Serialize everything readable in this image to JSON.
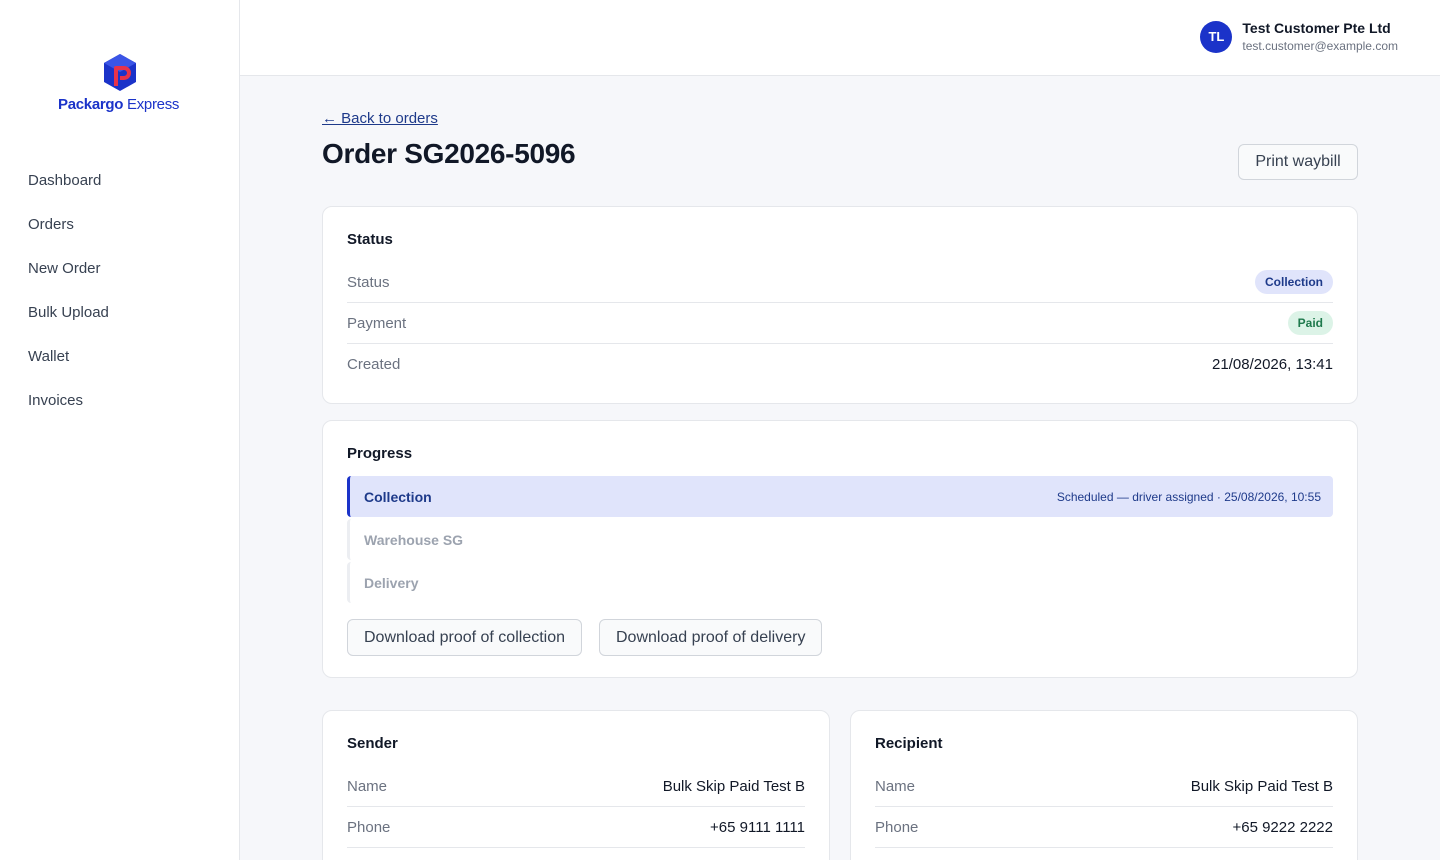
{
  "brand": {
    "name_bold": "Packargo",
    "name_light": " Express"
  },
  "sidebar": {
    "items": [
      {
        "label": "Dashboard"
      },
      {
        "label": "Orders"
      },
      {
        "label": "New Order"
      },
      {
        "label": "Bulk Upload"
      },
      {
        "label": "Wallet"
      },
      {
        "label": "Invoices"
      }
    ]
  },
  "user": {
    "initials": "TL",
    "name": "Test Customer Pte Ltd",
    "email": "test.customer@example.com"
  },
  "page": {
    "back_link": "← Back to orders",
    "title": "Order SG2026-5096",
    "print_label": "Print waybill"
  },
  "status_card": {
    "title": "Status",
    "status_label": "Status",
    "status_value": "Collection",
    "payment_label": "Payment",
    "payment_value": "Paid",
    "created_label": "Created",
    "created_value": "21/08/2026, 13:41"
  },
  "progress": {
    "title": "Progress",
    "steps": [
      {
        "name": "Collection",
        "info": "Scheduled — driver assigned · 25/08/2026, 10:55"
      },
      {
        "name": "Warehouse SG",
        "info": ""
      },
      {
        "name": "Delivery",
        "info": ""
      }
    ],
    "proof_collection_label": "Download proof of collection",
    "proof_delivery_label": "Download proof of delivery"
  },
  "sender": {
    "title": "Sender",
    "name_label": "Name",
    "name_value": "Bulk Skip Paid Test B",
    "phone_label": "Phone",
    "phone_value": "+65 9111 1111"
  },
  "recipient": {
    "title": "Recipient",
    "name_label": "Name",
    "name_value": "Bulk Skip Paid Test B",
    "phone_label": "Phone",
    "phone_value": "+65 9222 2222"
  },
  "colors": {
    "accent": "#1b33c9",
    "logo_red": "#e8334a"
  },
  "icons": {
    "logo": "packargo-logo-icon"
  }
}
